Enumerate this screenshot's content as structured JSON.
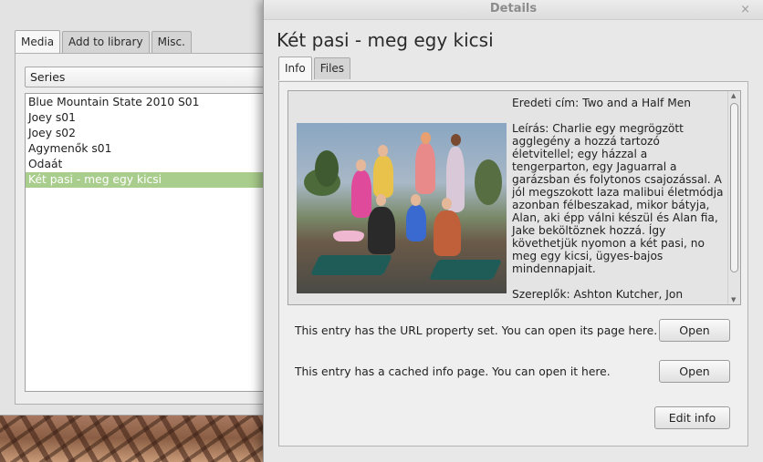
{
  "main_window": {
    "tabs": [
      {
        "label": "Media",
        "active": true
      },
      {
        "label": "Add to library",
        "active": false
      },
      {
        "label": "Misc.",
        "active": false
      }
    ],
    "category_select": "Series",
    "media_items": [
      {
        "label": "Blue Mountain State 2010 S01",
        "selected": false
      },
      {
        "label": "Joey s01",
        "selected": false
      },
      {
        "label": "Joey s02",
        "selected": false
      },
      {
        "label": "Agymenők s01",
        "selected": false
      },
      {
        "label": "Odaát",
        "selected": false
      },
      {
        "label": "Két pasi - meg egy kicsi",
        "selected": true
      }
    ],
    "selected_color": "#a9cd8c"
  },
  "dialog": {
    "window_title": "Details",
    "close_glyph": "×",
    "heading": "Két pasi - meg egy kicsi",
    "tabs": [
      {
        "label": "Info",
        "active": true
      },
      {
        "label": "Files",
        "active": false
      }
    ],
    "info": {
      "original_title": "Eredeti cím: Two and a Half Men",
      "description": "Leírás: Charlie egy megrögzött agglegény a hozzá tartozó életvitellel; egy házzal a tengerparton, egy Jaguarral a garázsban és folytonos csajozással. A jól megszokott laza malibui életmódja azonban félbeszakad, mikor bátyja, Alan, aki épp válni készül és Alan fia, Jake beköltöznek hozzá. Így követhetjük nyomon a két pasi, no meg egy kicsi, ügyes-bajos mindennapjait.",
      "cast": "Szereplők: Ashton  Kutcher, Jon"
    },
    "url_text": "This entry has the URL property set. You can open its page here.",
    "url_button": "Open",
    "cache_text": "This entry has a cached info page. You can open it here.",
    "cache_button": "Open",
    "edit_button": "Edit info",
    "icons": {
      "scroll_up": "scroll-up-arrow-icon",
      "scroll_down": "scroll-down-arrow-icon"
    }
  }
}
